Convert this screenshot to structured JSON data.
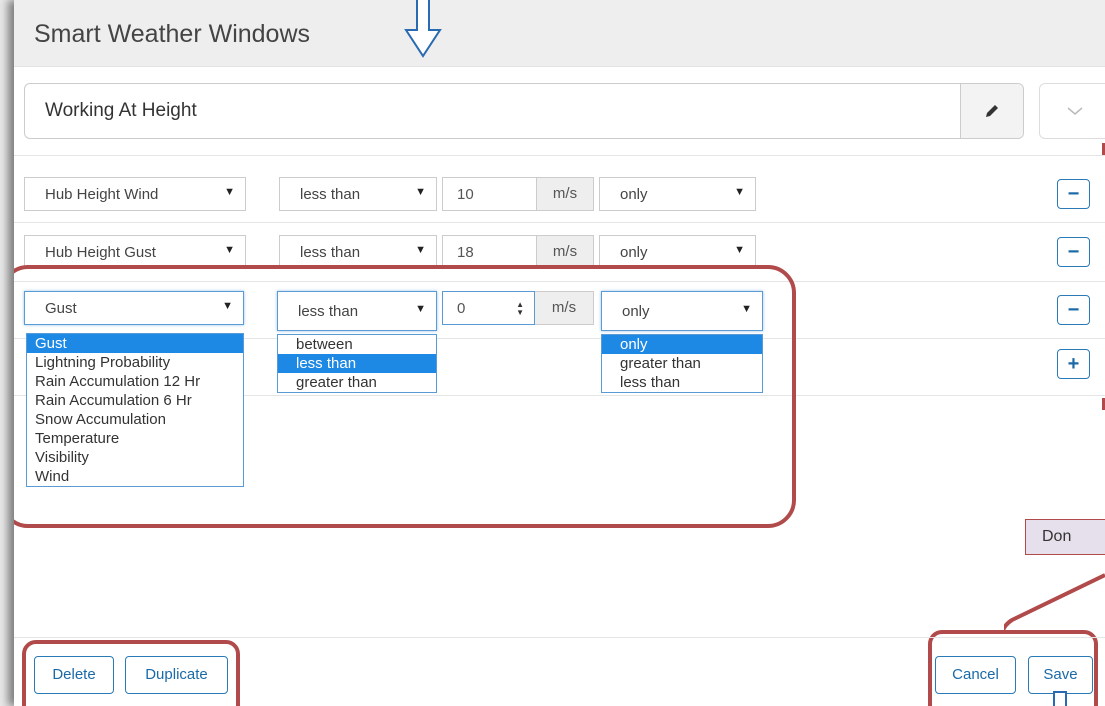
{
  "modal": {
    "title": "Smart Weather Windows",
    "name_value": "Working At Height"
  },
  "rules": [
    {
      "parameter": "Hub Height Wind",
      "operator": "less than",
      "value": "10",
      "unit": "m/s",
      "qualifier": "only"
    },
    {
      "parameter": "Hub Height Gust",
      "operator": "less than",
      "value": "18",
      "unit": "m/s",
      "qualifier": "only"
    },
    {
      "parameter": "Gust",
      "operator": "less than",
      "value": "0",
      "unit": "m/s",
      "qualifier": "only"
    }
  ],
  "parameter_options": [
    "Gust",
    "Lightning Probability",
    "Rain Accumulation 12 Hr",
    "Rain Accumulation 6 Hr",
    "Snow Accumulation",
    "Temperature",
    "Visibility",
    "Wind"
  ],
  "operator_options": [
    "between",
    "less than",
    "greater than"
  ],
  "qualifier_options": [
    "only",
    "greater than",
    "less than"
  ],
  "buttons": {
    "remove": "−",
    "add": "+",
    "delete": "Delete",
    "duplicate": "Duplicate",
    "cancel": "Cancel",
    "save": "Save"
  },
  "annotation_note": "Don",
  "colors": {
    "accent": "#2a7ab8",
    "annotation": "#b14a4a",
    "selected_option": "#1e88e5"
  },
  "icons": [
    "pencil-icon",
    "chevron-down-icon",
    "minus-icon",
    "plus-icon",
    "arrow-down-icon"
  ]
}
